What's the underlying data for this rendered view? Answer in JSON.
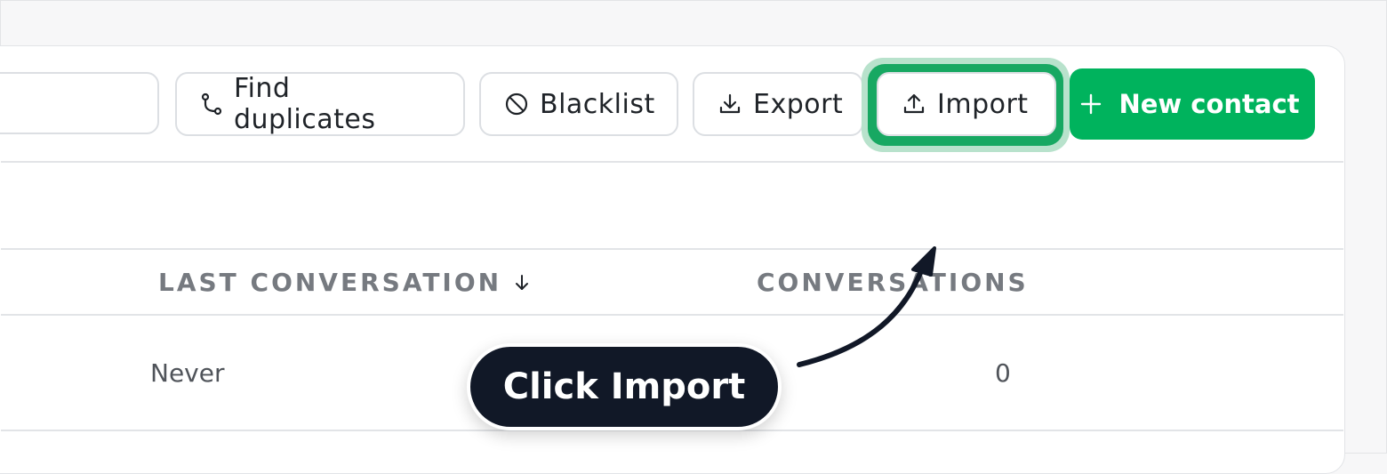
{
  "toolbar": {
    "find_duplicates_label": "Find duplicates",
    "blacklist_label": "Blacklist",
    "export_label": "Export",
    "import_label": "Import",
    "new_contact_label": "New contact"
  },
  "table": {
    "columns": [
      {
        "label": "LAST CONVERSATION",
        "sort_icon": "arrow-down-icon"
      },
      {
        "label": "CONVERSATIONS"
      }
    ],
    "rows": [
      {
        "last_conversation": "Never",
        "conversations": "0"
      }
    ]
  },
  "tooltip": {
    "text": "Click Import"
  },
  "colors": {
    "primary": "#00b35d",
    "highlight_ring": "#17a862",
    "tooltip_bg": "#111827",
    "header_text": "#767a80"
  }
}
